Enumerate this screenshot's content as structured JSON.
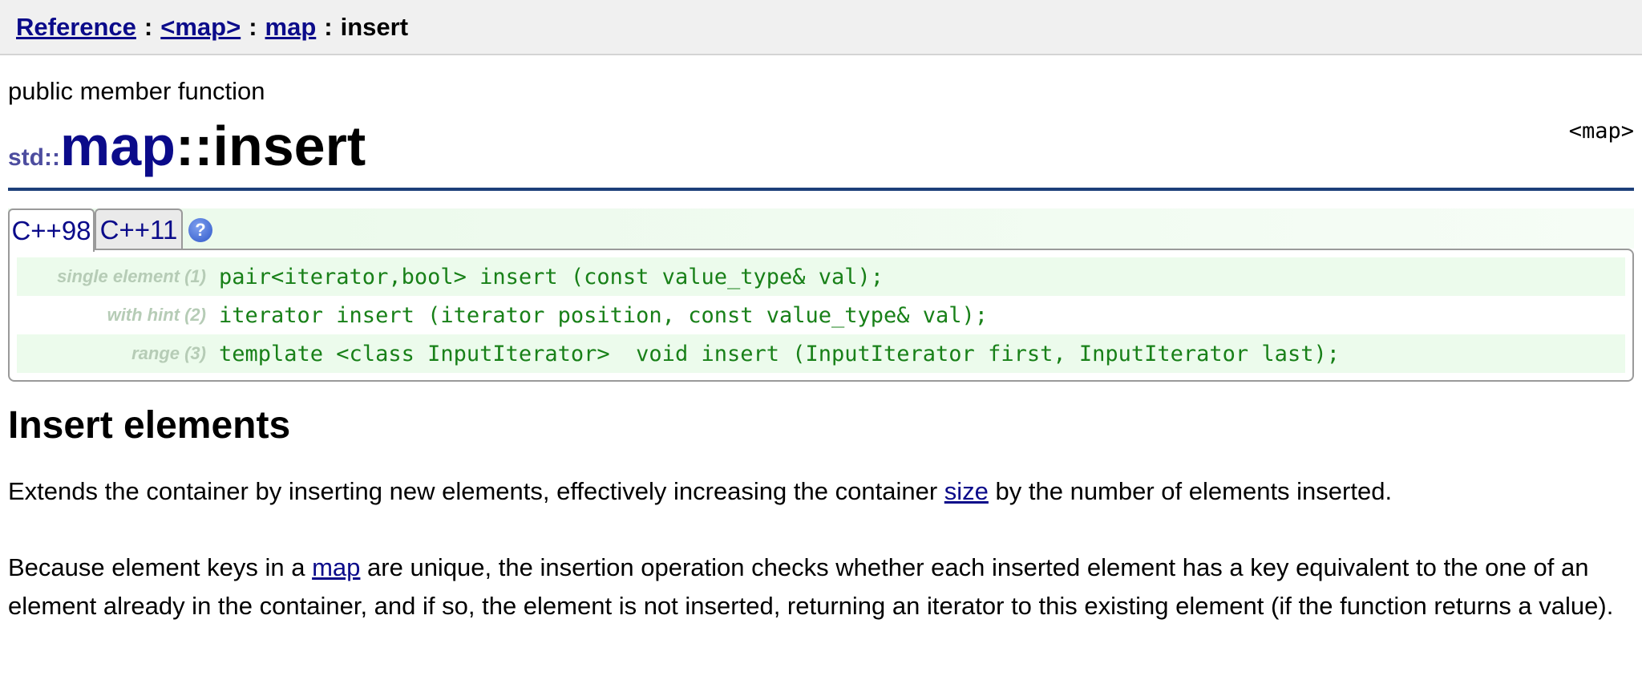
{
  "breadcrumb": {
    "items": [
      "Reference",
      "<map>",
      "map"
    ],
    "separator": ":",
    "current": "insert"
  },
  "member_type": "public member function",
  "header_ref": "<map>",
  "title": {
    "namespace": "std::",
    "class_name": "map",
    "separator": "::",
    "function": "insert"
  },
  "tabs": [
    {
      "label": "C++98",
      "active": true
    },
    {
      "label": "C++11",
      "active": false
    }
  ],
  "help_icon": "question-mark-icon",
  "help_glyph": "?",
  "declarations": [
    {
      "label": "single element (1)",
      "code": "pair<iterator,bool> insert (const value_type& val);"
    },
    {
      "label": "with hint (2)",
      "code": "iterator insert (iterator position, const value_type& val);"
    },
    {
      "label": "range (3)",
      "code": "template <class InputIterator>  void insert (InputIterator first, InputIterator last);"
    }
  ],
  "section_title": "Insert elements",
  "para1": {
    "before": "Extends the container by inserting new elements, effectively increasing the container ",
    "link": "size",
    "after": " by the number of elements inserted."
  },
  "para2": {
    "before": "Because element keys in a ",
    "link": "map",
    "after": " are unique, the insertion operation checks whether each inserted element has a key equivalent to the one of an element already in the container, and if so, the element is not inserted, returning an iterator to this existing element (if the function returns a value)."
  },
  "colors": {
    "link": "#0b0b8a",
    "code": "#188018",
    "rule": "#1d3f7a",
    "decl_shade": "#ecfbec"
  }
}
